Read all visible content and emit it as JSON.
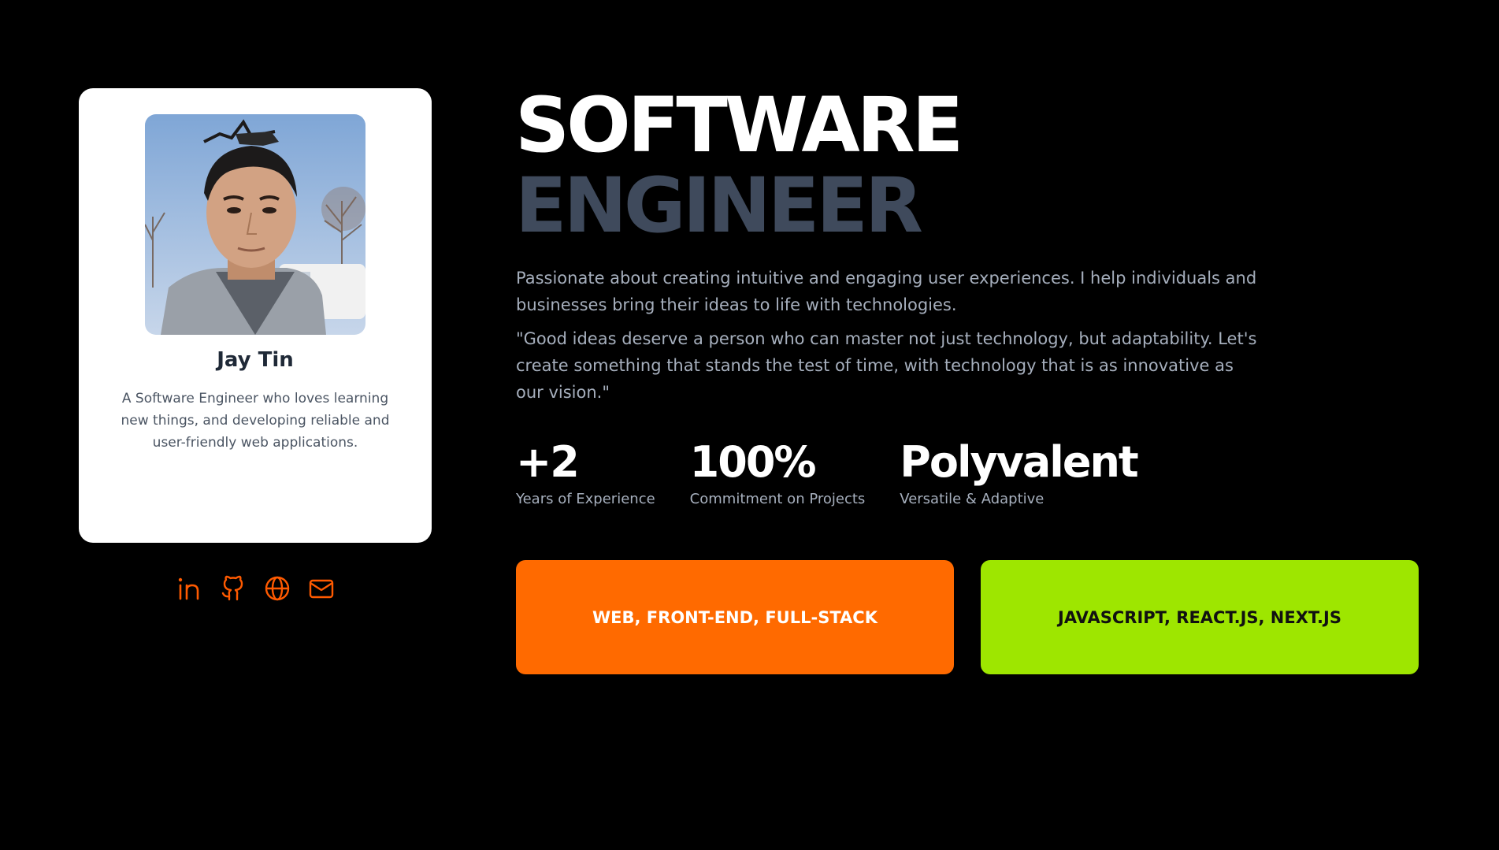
{
  "profile": {
    "name": "Jay Tin",
    "bio": "A Software Engineer who loves learning new things, and developing reliable and user-friendly web applications.",
    "photo_alt": "Jay Tin",
    "socials": [
      {
        "icon": "linkedin-icon"
      },
      {
        "icon": "github-icon"
      },
      {
        "icon": "globe-icon"
      },
      {
        "icon": "mail-icon"
      }
    ],
    "accent_color": "#ff5a00"
  },
  "hero": {
    "title_line1": "SOFTWARE",
    "title_line2": "ENGINEER",
    "paragraph1": "Passionate about creating intuitive and engaging user experiences. I help individuals and businesses bring their ideas to life with technologies.",
    "paragraph2": "\"Good ideas deserve a person who can master not just technology, but adaptability. Let's create something that stands the test of time, with technology that is as innovative as our vision.\""
  },
  "stats": [
    {
      "value": "+2",
      "label": "Years of Experience"
    },
    {
      "value": "100%",
      "label": "Commitment on Projects"
    },
    {
      "value": "Polyvalent",
      "label": "Versatile & Adaptive"
    }
  ],
  "tags": {
    "orange_label": "WEB, FRONT-END, FULL-STACK",
    "green_label": "JAVASCRIPT, REACT.JS, NEXT.JS",
    "orange_color": "#ff6a00",
    "green_color": "#9ee600"
  }
}
